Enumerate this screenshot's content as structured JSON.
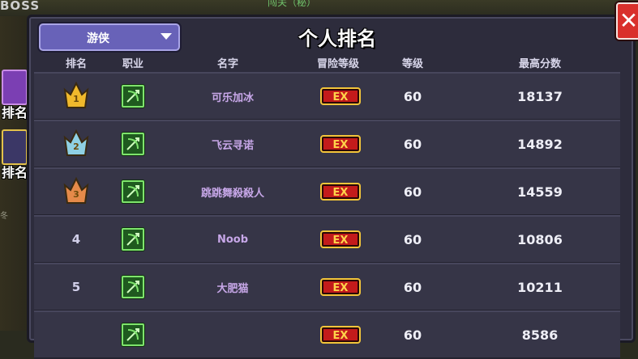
{
  "background": {
    "boss_label": "BOSS",
    "top_caption": "闯关（秘）"
  },
  "sidebar": {
    "tabs": [
      {
        "label": "排名"
      },
      {
        "label": "排名"
      }
    ],
    "small_text": "冬"
  },
  "panel": {
    "class_filter": "游侠",
    "title": "个人排名",
    "columns": [
      "排名",
      "职业",
      "名字",
      "冒险等级",
      "等级",
      "最高分数"
    ]
  },
  "ranking": [
    {
      "rank": "1",
      "name": "可乐加冰",
      "level": "60",
      "score": "18137",
      "crown": "gold"
    },
    {
      "rank": "2",
      "name": "飞云寻诺",
      "level": "60",
      "score": "14892",
      "crown": "silver"
    },
    {
      "rank": "3",
      "name": "跳跳舞殺殺人",
      "level": "60",
      "score": "14559",
      "crown": "bronze"
    },
    {
      "rank": "4",
      "name": "Noob",
      "level": "60",
      "score": "10806"
    },
    {
      "rank": "5",
      "name": "大肥猫",
      "level": "60",
      "score": "10211"
    },
    {
      "rank": "",
      "name": "",
      "level": "60",
      "score": "8586"
    }
  ],
  "colors": {
    "gold": "#f0b92c",
    "silver": "#8fd0e3",
    "bronze": "#e58a4a",
    "name": "#c7a7e8",
    "job": "#7ee46c"
  },
  "icons": {
    "job": "bow-icon",
    "adventure_level": "ex-badge-icon",
    "close": "close-icon",
    "dropdown": "chevron-down-icon"
  }
}
